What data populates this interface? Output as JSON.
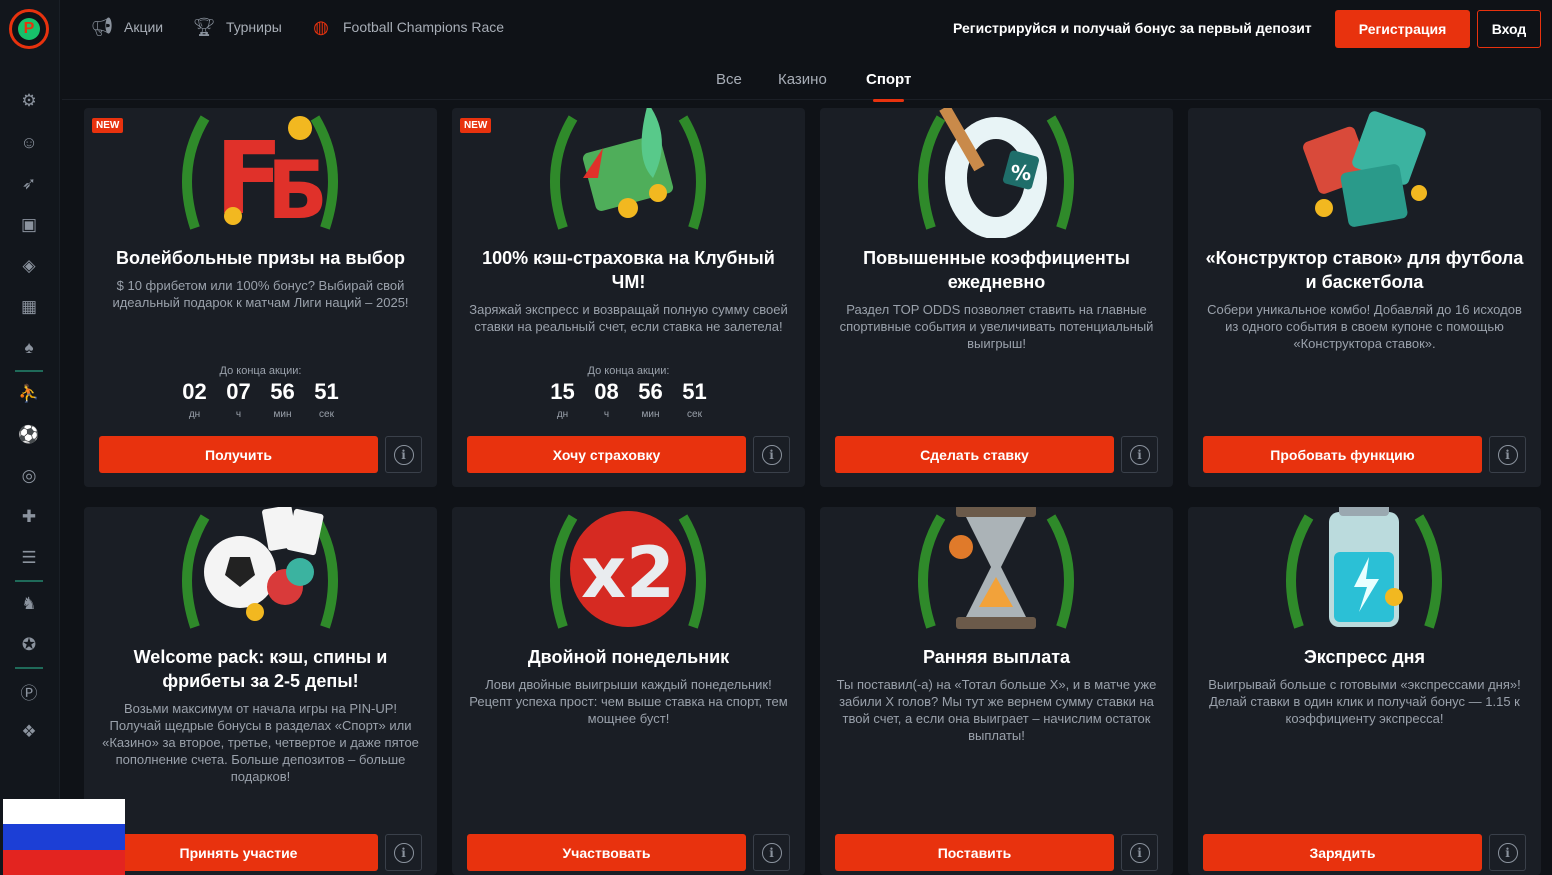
{
  "colors": {
    "accent": "#e8320e",
    "bg": "#0f1217",
    "card": "#1a1e25",
    "text_muted": "#9aa1ab"
  },
  "sidebar": {
    "logo": "pin-up-logo",
    "icons": [
      "gear-icon",
      "support-agent-icon",
      "rocket-icon",
      "tv-icon",
      "poker-chip-icon",
      "bingo-icon",
      "cards-icon",
      "basketball-player-icon",
      "soccer-ball-icon",
      "target-icon",
      "gamepad-icon",
      "news-icon",
      "horse-racing-icon",
      "trophy-ball-icon",
      "pinup-coin-icon",
      "gift-icon"
    ]
  },
  "topnav": {
    "items": [
      {
        "label": "Акции",
        "icon": "megaphone-icon"
      },
      {
        "label": "Турниры",
        "icon": "trophy-icon"
      },
      {
        "label": "Football Champions Race",
        "icon": "lifebuoy-icon"
      }
    ],
    "promo_text": "Регистрируйся и получай бонус за первый депозит",
    "register_label": "Регистрация",
    "login_label": "Вход"
  },
  "tabs": [
    {
      "label": "Все",
      "active": false
    },
    {
      "label": "Казино",
      "active": false
    },
    {
      "label": "Спорт",
      "active": true
    }
  ],
  "cards": [
    {
      "badge": "NEW",
      "illustration": "fb-logo-laurel-icon",
      "title": "Волейбольные призы на выбор",
      "description": "$ 10 фрибетом или 100% бонус? Выбирай свой идеальный подарок к матчам Лиги наций – 2025!",
      "countdown": {
        "label": "До конца акции:",
        "days": "02",
        "hours": "07",
        "minutes": "56",
        "seconds": "51",
        "days_label": "дн",
        "hours_label": "ч",
        "minutes_label": "мин",
        "seconds_label": "сек"
      },
      "button": "Получить"
    },
    {
      "badge": "NEW",
      "illustration": "cash-insurance-laurel-icon",
      "title": "100% кэш-страховка на Клубный ЧМ!",
      "description": "Заряжай экспресс и возвращай полную сумму своей ставки на реальный счет, если ставка не залетела!",
      "countdown": {
        "label": "До конца акции:",
        "days": "15",
        "hours": "08",
        "minutes": "56",
        "seconds": "51",
        "days_label": "дн",
        "hours_label": "ч",
        "minutes_label": "мин",
        "seconds_label": "сек"
      },
      "button": "Хочу страховку"
    },
    {
      "badge": "",
      "illustration": "top-odds-percent-icon",
      "title": "Повышенные коэффициенты ежедневно",
      "description": "Раздел TOP ODDS позволяет ставить на главные спортивные события и увеличивать потенциальный выигрыш!",
      "button": "Сделать ставку"
    },
    {
      "badge": "",
      "illustration": "bet-builder-puzzle-icon",
      "title": "«Конструктор ставок» для футбола и баскетбола",
      "description": "Собери уникальное комбо! Добавляй до 16 исходов из одного события в своем купоне с помощью «Конструктора ставок».",
      "button": "Пробовать функцию"
    },
    {
      "badge": "",
      "illustration": "welcome-pack-ball-cards-icon",
      "title": "Welcome pack: кэш, спины и фрибеты за 2-5 депы!",
      "description": "Возьми максимум от начала игры на PIN-UP! Получай щедрые бонусы в разделах «Спорт» или «Казино» за второе, третье, четвертое и даже пятое пополнение счета. Больше депозитов – больше подарков!",
      "button": "Принять участие"
    },
    {
      "badge": "",
      "illustration": "x2-icon",
      "title": "Двойной понедельник",
      "description": "Лови двойные выигрыши каждый понедельник! Рецепт успеха прост: чем выше ставка на спорт, тем мощнее буст!",
      "button": "Участвовать"
    },
    {
      "badge": "",
      "illustration": "hourglass-icon",
      "title": "Ранняя выплата",
      "description": "Ты поставил(-а) на «Тотал больше Х», и в матче уже забили Х голов? Мы тут же вернем сумму ставки на твой счет, а если она выиграет – начислим остаток выплаты!",
      "button": "Поставить"
    },
    {
      "badge": "",
      "illustration": "battery-charge-icon",
      "title": "Экспресс дня",
      "description": "Выигрывай больше с готовыми «экспрессами дня»! Делай ставки в один клик и получай бонус — 1.15 к коэффициенту экспресса!",
      "button": "Зарядить"
    }
  ],
  "flag": "russia-flag-icon"
}
